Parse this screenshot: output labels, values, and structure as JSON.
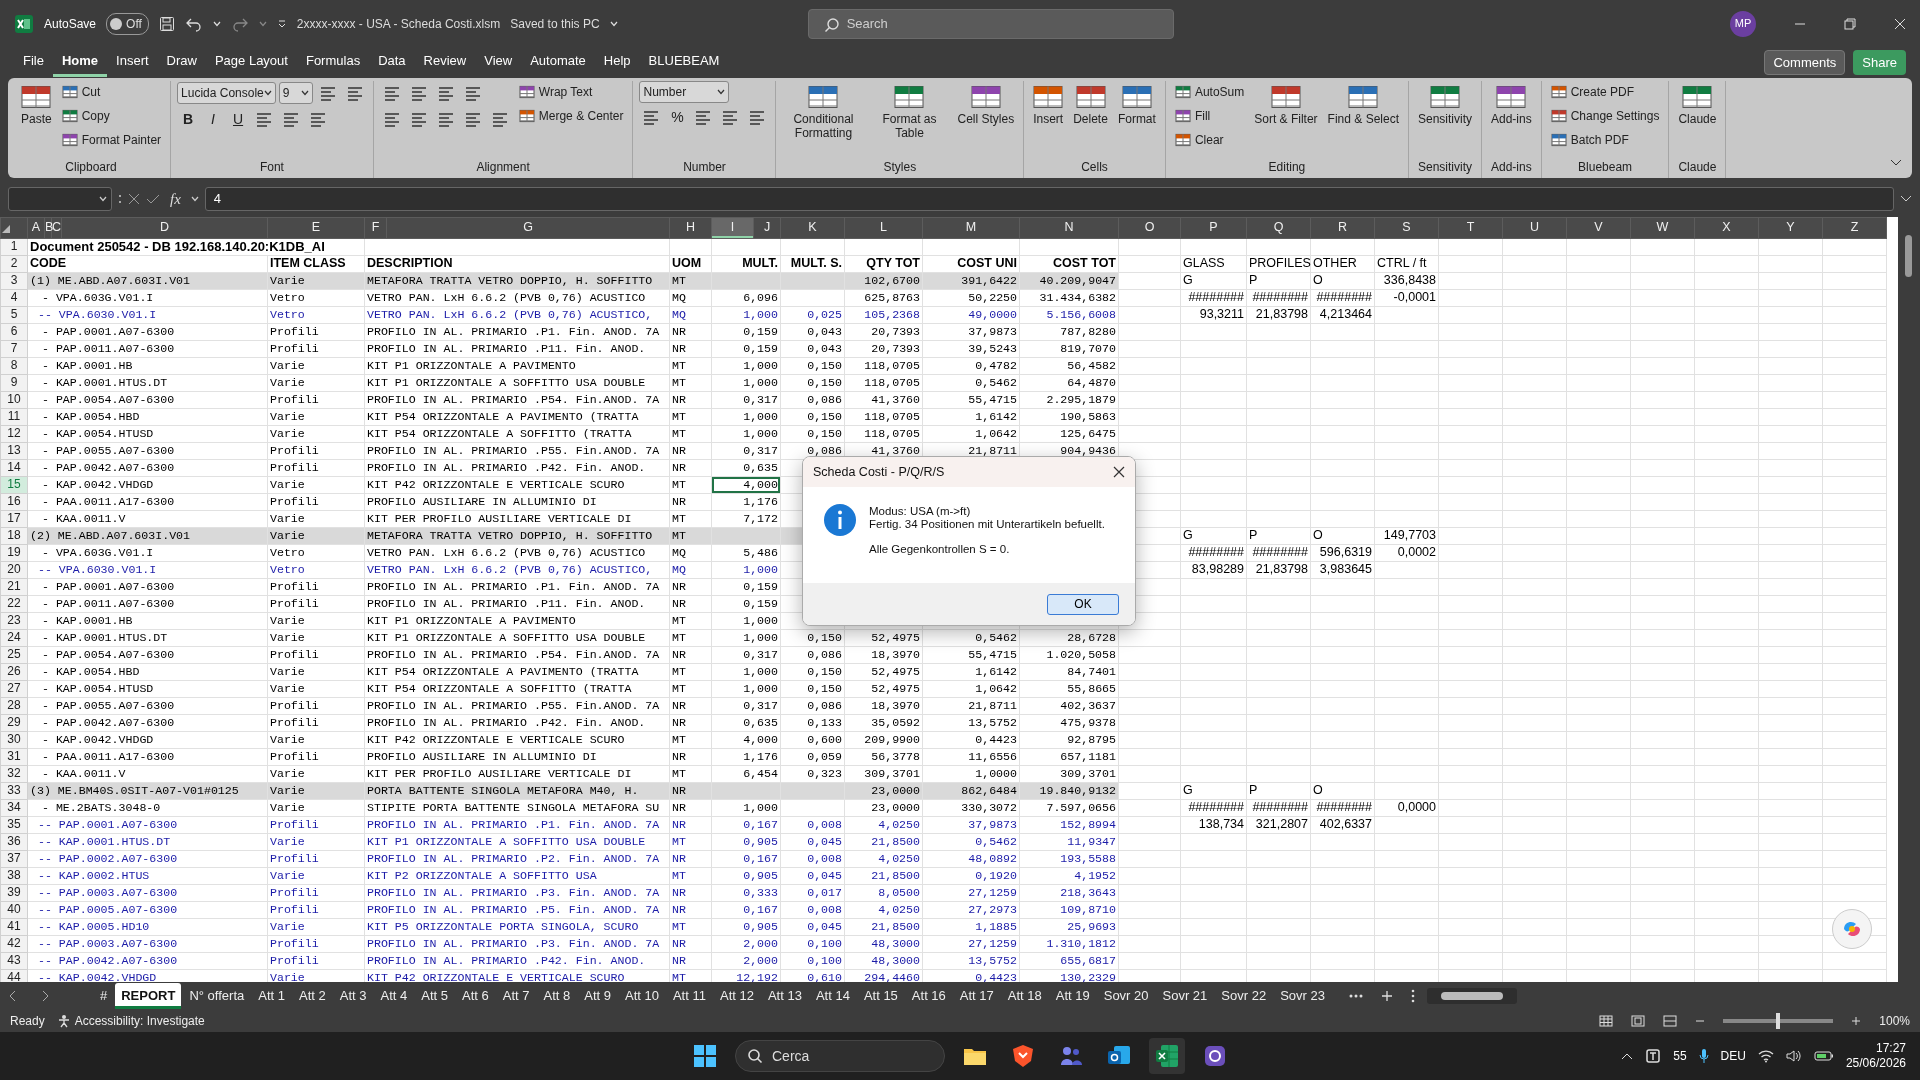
{
  "title_bar": {
    "autosave_label": "AutoSave",
    "autosave_on": false,
    "autosave_text": "Off",
    "file_name": "2xxxx-xxxx - USA - Scheda Costi.xlsm",
    "save_status": "Saved to this PC",
    "search_placeholder": "Search",
    "avatar": "MP"
  },
  "menu_tabs": [
    {
      "label": "File",
      "selected": false
    },
    {
      "label": "Home",
      "selected": true
    },
    {
      "label": "Insert",
      "selected": false
    },
    {
      "label": "Draw",
      "selected": false
    },
    {
      "label": "Page Layout",
      "selected": false
    },
    {
      "label": "Formulas",
      "selected": false
    },
    {
      "label": "Data",
      "selected": false
    },
    {
      "label": "Review",
      "selected": false
    },
    {
      "label": "View",
      "selected": false
    },
    {
      "label": "Automate",
      "selected": false
    },
    {
      "label": "Help",
      "selected": false
    },
    {
      "label": "BLUEBEAM",
      "selected": false
    }
  ],
  "comments_button": "Comments",
  "share_button": "Share",
  "ribbon": [
    {
      "label": "Clipboard",
      "columns": [
        [
          [
            {
              "kind": "large",
              "label": "Paste"
            }
          ]
        ],
        [
          [
            {
              "kind": "small",
              "label": "Cut"
            }
          ],
          [
            {
              "kind": "small",
              "label": "Copy"
            }
          ],
          [
            {
              "kind": "small",
              "label": "Format Painter"
            }
          ]
        ]
      ]
    },
    {
      "label": "Font",
      "columns": [
        [
          [
            {
              "kind": "combo",
              "value": "Lucida Console"
            },
            {
              "kind": "combo",
              "value": "9"
            },
            {
              "kind": "icon"
            },
            {
              "kind": "icon"
            }
          ],
          [
            {
              "kind": "bold",
              "label": "B"
            },
            {
              "kind": "italic",
              "label": "I"
            },
            {
              "kind": "underline",
              "label": "U"
            },
            {
              "kind": "icon"
            },
            {
              "kind": "icon"
            },
            {
              "kind": "icon"
            }
          ]
        ]
      ]
    },
    {
      "label": "Alignment",
      "columns": [
        [
          [
            {
              "kind": "icon"
            },
            {
              "kind": "icon"
            },
            {
              "kind": "icon"
            },
            {
              "kind": "icon"
            }
          ],
          [
            {
              "kind": "icon"
            },
            {
              "kind": "icon"
            },
            {
              "kind": "icon"
            },
            {
              "kind": "icon"
            },
            {
              "kind": "icon"
            }
          ]
        ],
        [
          [
            {
              "kind": "small",
              "label": "Wrap Text"
            }
          ],
          [
            {
              "kind": "small",
              "label": "Merge & Center"
            }
          ]
        ]
      ]
    },
    {
      "label": "Number",
      "columns": [
        [
          [
            {
              "kind": "combo",
              "value": "Number"
            }
          ],
          [
            {
              "kind": "icon"
            },
            {
              "kind": "glyph",
              "label": "%"
            },
            {
              "kind": "icon"
            },
            {
              "kind": "icon"
            },
            {
              "kind": "icon"
            }
          ]
        ]
      ]
    },
    {
      "label": "Styles",
      "columns": [
        [
          [
            {
              "kind": "large",
              "label": "Conditional Formatting"
            }
          ]
        ],
        [
          [
            {
              "kind": "large",
              "label": "Format as Table"
            }
          ]
        ],
        [
          [
            {
              "kind": "large",
              "label": "Cell Styles"
            }
          ]
        ]
      ]
    },
    {
      "label": "Cells",
      "columns": [
        [
          [
            {
              "kind": "large",
              "label": "Insert"
            }
          ]
        ],
        [
          [
            {
              "kind": "large",
              "label": "Delete"
            }
          ]
        ],
        [
          [
            {
              "kind": "large",
              "label": "Format"
            }
          ]
        ]
      ]
    },
    {
      "label": "Editing",
      "columns": [
        [
          [
            {
              "kind": "small",
              "label": "AutoSum"
            }
          ],
          [
            {
              "kind": "small",
              "label": "Fill"
            }
          ],
          [
            {
              "kind": "small",
              "label": "Clear"
            }
          ]
        ],
        [
          [
            {
              "kind": "large",
              "label": "Sort & Filter"
            }
          ]
        ],
        [
          [
            {
              "kind": "large",
              "label": "Find & Select"
            }
          ]
        ]
      ]
    },
    {
      "label": "Sensitivity",
      "columns": [
        [
          [
            {
              "kind": "large",
              "label": "Sensitivity"
            }
          ]
        ]
      ]
    },
    {
      "label": "Add-ins",
      "columns": [
        [
          [
            {
              "kind": "large",
              "label": "Add-ins"
            }
          ]
        ]
      ]
    },
    {
      "label": "Bluebeam",
      "columns": [
        [
          [
            {
              "kind": "small",
              "label": "Create PDF"
            }
          ],
          [
            {
              "kind": "small",
              "label": "Change Settings"
            }
          ],
          [
            {
              "kind": "small",
              "label": "Batch PDF"
            }
          ]
        ]
      ]
    },
    {
      "label": "Claude",
      "columns": [
        [
          [
            {
              "kind": "large",
              "label": "Claude"
            }
          ]
        ]
      ]
    }
  ],
  "formula_bar": {
    "fx_label": "fx",
    "value": "4"
  },
  "sheet": {
    "columns": [
      {
        "label": "A",
        "selected": false
      },
      {
        "label": "B",
        "selected": false
      },
      {
        "label": "C",
        "selected": false
      },
      {
        "label": "D",
        "selected": false
      },
      {
        "label": "E",
        "selected": false
      },
      {
        "label": "F",
        "selected": false
      },
      {
        "label": "G",
        "selected": false
      },
      {
        "label": "H",
        "selected": false
      },
      {
        "label": "I",
        "selected": true
      },
      {
        "label": "J",
        "selected": false
      },
      {
        "label": "K",
        "selected": false
      },
      {
        "label": "L",
        "selected": false
      },
      {
        "label": "M",
        "selected": false
      },
      {
        "label": "N",
        "selected": false
      },
      {
        "label": "O",
        "selected": false
      },
      {
        "label": "P",
        "selected": false
      },
      {
        "label": "Q",
        "selected": false
      },
      {
        "label": "R",
        "selected": false
      },
      {
        "label": "S",
        "selected": false
      },
      {
        "label": "T",
        "selected": false
      },
      {
        "label": "U",
        "selected": false
      },
      {
        "label": "V",
        "selected": false
      },
      {
        "label": "W",
        "selected": false
      },
      {
        "label": "X",
        "selected": false
      },
      {
        "label": "Y",
        "selected": false
      },
      {
        "label": "Z",
        "selected": false
      }
    ],
    "rows": [
      {
        "n": "1",
        "kind": "title",
        "selected": false,
        "cells": {
          "A": "Document 250542 - DB 192.168.140.20:K1DB_AI"
        }
      },
      {
        "n": "2",
        "kind": "header",
        "selected": false,
        "cells": {
          "A": "CODE",
          "E": "ITEM CLASS",
          "F": "DESCRIPTION",
          "H": "UOM",
          "I": "MULT.",
          "K": "MULT. S.",
          "L": "QTY TOT",
          "M": "COST UNI",
          "N": "COST TOT",
          "P": "GLASS",
          "Q": "PROFILES",
          "R": "OTHER",
          "S": "CTRL / ft"
        }
      },
      {
        "n": "3",
        "kind": "group",
        "selected": false,
        "cells": {
          "A": "(1) ME.ABD.A07.603I.V01",
          "E": "Varie",
          "F": "METAFORA TRATTA VETRO DOPPIO, H. SOFFITTO",
          "H": "MT",
          "L": "102,6700",
          "M": "391,6422",
          "N": "40.209,9047",
          "P": "G",
          "Q": "P",
          "R": "O",
          "S": "336,8438"
        }
      },
      {
        "n": "4",
        "kind": "item",
        "selected": false,
        "cells": {
          "A": "- VPA.603G.V01.I",
          "E": "Vetro",
          "F": "VETRO PAN. LxH 6.6.2 (PVB 0,76) ACUSTICO",
          "H": "MQ",
          "I": "6,096",
          "L": "625,8763",
          "M": "50,2250",
          "N": "31.434,6382",
          "P": "########",
          "Q": "########",
          "R": "########",
          "S": "-0,0001"
        }
      },
      {
        "n": "5",
        "kind": "sub",
        "selected": false,
        "cells": {
          "A": "-- VPA.6030.V01.I",
          "E": "Vetro",
          "F": "VETRO PAN. LxH 6.6.2 (PVB 0,76) ACUSTICO,",
          "H": "MQ",
          "I": "1,000",
          "K": "0,025",
          "L": "105,2368",
          "M": "49,0000",
          "N": "5.156,6008",
          "P": "93,3211",
          "Q": "21,83798",
          "R": "4,213464"
        }
      },
      {
        "n": "6",
        "kind": "item",
        "selected": false,
        "cells": {
          "A": "- PAP.0001.A07-6300",
          "E": "Profili",
          "F": "PROFILO IN AL. PRIMARIO .P1. Fin. ANOD. 7A",
          "H": "NR",
          "I": "0,159",
          "K": "0,043",
          "L": "20,7393",
          "M": "37,9873",
          "N": "787,8280"
        }
      },
      {
        "n": "7",
        "kind": "item",
        "selected": false,
        "cells": {
          "A": "- PAP.0011.A07-6300",
          "E": "Profili",
          "F": "PROFILO IN AL. PRIMARIO .P11. Fin. ANOD.",
          "H": "NR",
          "I": "0,159",
          "K": "0,043",
          "L": "20,7393",
          "M": "39,5243",
          "N": "819,7070"
        }
      },
      {
        "n": "8",
        "kind": "item",
        "selected": false,
        "cells": {
          "A": "- KAP.0001.HB",
          "E": "Varie",
          "F": "KIT P1 ORIZZONTALE A PAVIMENTO",
          "H": "MT",
          "I": "1,000",
          "K": "0,150",
          "L": "118,0705",
          "M": "0,4782",
          "N": "56,4582"
        }
      },
      {
        "n": "9",
        "kind": "item",
        "selected": false,
        "cells": {
          "A": "- KAP.0001.HTUS.DT",
          "E": "Varie",
          "F": "KIT P1 ORIZZONTALE A SOFFITTO USA DOUBLE",
          "H": "MT",
          "I": "1,000",
          "K": "0,150",
          "L": "118,0705",
          "M": "0,5462",
          "N": "64,4870"
        }
      },
      {
        "n": "10",
        "kind": "item",
        "selected": false,
        "cells": {
          "A": "- PAP.0054.A07-6300",
          "E": "Profili",
          "F": "PROFILO IN AL. PRIMARIO .P54. Fin.ANOD. 7A",
          "H": "NR",
          "I": "0,317",
          "K": "0,086",
          "L": "41,3760",
          "M": "55,4715",
          "N": "2.295,1879"
        }
      },
      {
        "n": "11",
        "kind": "item",
        "selected": false,
        "cells": {
          "A": "- KAP.0054.HBD",
          "E": "Varie",
          "F": "KIT P54 ORIZZONTALE A PAVIMENTO (TRATTA",
          "H": "MT",
          "I": "1,000",
          "K": "0,150",
          "L": "118,0705",
          "M": "1,6142",
          "N": "190,5863"
        }
      },
      {
        "n": "12",
        "kind": "item",
        "selected": false,
        "cells": {
          "A": "- KAP.0054.HTUSD",
          "E": "Varie",
          "F": "KIT P54 ORIZZONTALE A SOFFITTO (TRATTA",
          "H": "MT",
          "I": "1,000",
          "K": "0,150",
          "L": "118,0705",
          "M": "1,0642",
          "N": "125,6475"
        }
      },
      {
        "n": "13",
        "kind": "item",
        "selected": false,
        "cells": {
          "A": "- PAP.0055.A07-6300",
          "E": "Profili",
          "F": "PROFILO IN AL. PRIMARIO .P55. Fin.ANOD. 7A",
          "H": "NR",
          "I": "0,317",
          "K": "0,086",
          "L": "41,3760",
          "M": "21,8711",
          "N": "904,9436"
        }
      },
      {
        "n": "14",
        "kind": "item",
        "selected": false,
        "cells": {
          "A": "- PAP.0042.A07-6300",
          "E": "Profili",
          "F": "PROFILO IN AL. PRIMARIO .P42. Fin. ANOD.",
          "H": "NR",
          "I": "0,635"
        }
      },
      {
        "n": "15",
        "kind": "item",
        "selected": true,
        "cells": {
          "A": "- KAP.0042.VHDGD",
          "E": "Varie",
          "F": "KIT P42 ORIZZONTALE E VERTICALE SCURO",
          "H": "MT",
          "I": "4,000"
        }
      },
      {
        "n": "16",
        "kind": "item",
        "selected": false,
        "cells": {
          "A": "- PAA.0011.A17-6300",
          "E": "Profili",
          "F": "PROFILO AUSILIARE IN ALLUMINIO DI",
          "H": "NR",
          "I": "1,176"
        }
      },
      {
        "n": "17",
        "kind": "item",
        "selected": false,
        "cells": {
          "A": "- KAA.0011.V",
          "E": "Varie",
          "F": "KIT PER PROFILO AUSILIARE VERTICALE DI",
          "H": "MT",
          "I": "7,172"
        }
      },
      {
        "n": "18",
        "kind": "group",
        "selected": false,
        "cells": {
          "A": "(2) ME.ABD.A07.603I.V01",
          "E": "Varie",
          "F": "METAFORA TRATTA VETRO DOPPIO, H. SOFFITTO",
          "H": "MT",
          "P": "G",
          "Q": "P",
          "R": "O",
          "S": "149,7703"
        }
      },
      {
        "n": "19",
        "kind": "item",
        "selected": false,
        "cells": {
          "A": "- VPA.603G.V01.I",
          "E": "Vetro",
          "F": "VETRO PAN. LxH 6.6.2 (PVB 0,76) ACUSTICO",
          "H": "MQ",
          "I": "5,486",
          "P": "########",
          "Q": "########",
          "R": "596,6319",
          "S": "0,0002"
        }
      },
      {
        "n": "20",
        "kind": "sub",
        "selected": false,
        "cells": {
          "A": "-- VPA.6030.V01.I",
          "E": "Vetro",
          "F": "VETRO PAN. LxH 6.6.2 (PVB 0,76) ACUSTICO,",
          "H": "MQ",
          "I": "1,000",
          "P": "83,98289",
          "Q": "21,83798",
          "R": "3,983645"
        }
      },
      {
        "n": "21",
        "kind": "item",
        "selected": false,
        "cells": {
          "A": "- PAP.0001.A07-6300",
          "E": "Profili",
          "F": "PROFILO IN AL. PRIMARIO .P1. Fin. ANOD. 7A",
          "H": "NR",
          "I": "0,159"
        }
      },
      {
        "n": "22",
        "kind": "item",
        "selected": false,
        "cells": {
          "A": "- PAP.0011.A07-6300",
          "E": "Profili",
          "F": "PROFILO IN AL. PRIMARIO .P11. Fin. ANOD.",
          "H": "NR",
          "I": "0,159"
        }
      },
      {
        "n": "23",
        "kind": "item",
        "selected": false,
        "cells": {
          "A": "- KAP.0001.HB",
          "E": "Varie",
          "F": "KIT P1 ORIZZONTALE A PAVIMENTO",
          "H": "MT",
          "I": "1,000"
        }
      },
      {
        "n": "24",
        "kind": "item",
        "selected": false,
        "cells": {
          "A": "- KAP.0001.HTUS.DT",
          "E": "Varie",
          "F": "KIT P1 ORIZZONTALE A SOFFITTO USA DOUBLE",
          "H": "MT",
          "I": "1,000",
          "K": "0,150",
          "L": "52,4975",
          "M": "0,5462",
          "N": "28,6728"
        }
      },
      {
        "n": "25",
        "kind": "item",
        "selected": false,
        "cells": {
          "A": "- PAP.0054.A07-6300",
          "E": "Profili",
          "F": "PROFILO IN AL. PRIMARIO .P54. Fin.ANOD. 7A",
          "H": "NR",
          "I": "0,317",
          "K": "0,086",
          "L": "18,3970",
          "M": "55,4715",
          "N": "1.020,5058"
        }
      },
      {
        "n": "26",
        "kind": "item",
        "selected": false,
        "cells": {
          "A": "- KAP.0054.HBD",
          "E": "Varie",
          "F": "KIT P54 ORIZZONTALE A PAVIMENTO (TRATTA",
          "H": "MT",
          "I": "1,000",
          "K": "0,150",
          "L": "52,4975",
          "M": "1,6142",
          "N": "84,7401"
        }
      },
      {
        "n": "27",
        "kind": "item",
        "selected": false,
        "cells": {
          "A": "- KAP.0054.HTUSD",
          "E": "Varie",
          "F": "KIT P54 ORIZZONTALE A SOFFITTO (TRATTA",
          "H": "MT",
          "I": "1,000",
          "K": "0,150",
          "L": "52,4975",
          "M": "1,0642",
          "N": "55,8665"
        }
      },
      {
        "n": "28",
        "kind": "item",
        "selected": false,
        "cells": {
          "A": "- PAP.0055.A07-6300",
          "E": "Profili",
          "F": "PROFILO IN AL. PRIMARIO .P55. Fin.ANOD. 7A",
          "H": "NR",
          "I": "0,317",
          "K": "0,086",
          "L": "18,3970",
          "M": "21,8711",
          "N": "402,3637"
        }
      },
      {
        "n": "29",
        "kind": "item",
        "selected": false,
        "cells": {
          "A": "- PAP.0042.A07-6300",
          "E": "Profili",
          "F": "PROFILO IN AL. PRIMARIO .P42. Fin. ANOD.",
          "H": "NR",
          "I": "0,635",
          "K": "0,133",
          "L": "35,0592",
          "M": "13,5752",
          "N": "475,9378"
        }
      },
      {
        "n": "30",
        "kind": "item",
        "selected": false,
        "cells": {
          "A": "- KAP.0042.VHDGD",
          "E": "Varie",
          "F": "KIT P42 ORIZZONTALE E VERTICALE SCURO",
          "H": "MT",
          "I": "4,000",
          "K": "0,600",
          "L": "209,9900",
          "M": "0,4423",
          "N": "92,8795"
        }
      },
      {
        "n": "31",
        "kind": "item",
        "selected": false,
        "cells": {
          "A": "- PAA.0011.A17-6300",
          "E": "Profili",
          "F": "PROFILO AUSILIARE IN ALLUMINIO DI",
          "H": "NR",
          "I": "1,176",
          "K": "0,059",
          "L": "56,3778",
          "M": "11,6556",
          "N": "657,1181"
        }
      },
      {
        "n": "32",
        "kind": "item",
        "selected": false,
        "cells": {
          "A": "- KAA.0011.V",
          "E": "Varie",
          "F": "KIT PER PROFILO AUSILIARE VERTICALE DI",
          "H": "MT",
          "I": "6,454",
          "K": "0,323",
          "L": "309,3701",
          "M": "1,0000",
          "N": "309,3701"
        }
      },
      {
        "n": "33",
        "kind": "group",
        "selected": false,
        "cells": {
          "A": "(3) ME.BM40S.0SIT-A07-V01#0125",
          "E": "Varie",
          "F": "PORTA BATTENTE SINGOLA METAFORA M40, H.",
          "H": "NR",
          "L": "23,0000",
          "M": "862,6484",
          "N": "19.840,9132",
          "P": "G",
          "Q": "P",
          "R": "O"
        }
      },
      {
        "n": "34",
        "kind": "item",
        "selected": false,
        "cells": {
          "A": "- ME.2BATS.3048-0",
          "E": "Varie",
          "F": "STIPITE PORTA BATTENTE SINGOLA METAFORA SU",
          "H": "NR",
          "I": "1,000",
          "L": "23,0000",
          "M": "330,3072",
          "N": "7.597,0656",
          "P": "########",
          "Q": "########",
          "R": "########",
          "S": "0,0000"
        }
      },
      {
        "n": "35",
        "kind": "sub",
        "selected": false,
        "cells": {
          "A": "-- PAP.0001.A07-6300",
          "E": "Profili",
          "F": "PROFILO IN AL. PRIMARIO .P1. Fin. ANOD. 7A",
          "H": "NR",
          "I": "0,167",
          "K": "0,008",
          "L": "4,0250",
          "M": "37,9873",
          "N": "152,8994",
          "P": "138,734",
          "Q": "321,2807",
          "R": "402,6337"
        }
      },
      {
        "n": "36",
        "kind": "sub",
        "selected": false,
        "cells": {
          "A": "-- KAP.0001.HTUS.DT",
          "E": "Varie",
          "F": "KIT P1 ORIZZONTALE A SOFFITTO USA DOUBLE",
          "H": "MT",
          "I": "0,905",
          "K": "0,045",
          "L": "21,8500",
          "M": "0,5462",
          "N": "11,9347"
        }
      },
      {
        "n": "37",
        "kind": "sub",
        "selected": false,
        "cells": {
          "A": "-- PAP.0002.A07-6300",
          "E": "Profili",
          "F": "PROFILO IN AL. PRIMARIO .P2. Fin. ANOD. 7A",
          "H": "NR",
          "I": "0,167",
          "K": "0,008",
          "L": "4,0250",
          "M": "48,0892",
          "N": "193,5588"
        }
      },
      {
        "n": "38",
        "kind": "sub",
        "selected": false,
        "cells": {
          "A": "-- KAP.0002.HTUS",
          "E": "Varie",
          "F": "KIT P2 ORIZZONTALE A SOFFITTO USA",
          "H": "MT",
          "I": "0,905",
          "K": "0,045",
          "L": "21,8500",
          "M": "0,1920",
          "N": "4,1952"
        }
      },
      {
        "n": "39",
        "kind": "sub",
        "selected": false,
        "cells": {
          "A": "-- PAP.0003.A07-6300",
          "E": "Profili",
          "F": "PROFILO IN AL. PRIMARIO .P3. Fin. ANOD. 7A",
          "H": "NR",
          "I": "0,333",
          "K": "0,017",
          "L": "8,0500",
          "M": "27,1259",
          "N": "218,3643"
        }
      },
      {
        "n": "40",
        "kind": "sub",
        "selected": false,
        "cells": {
          "A": "-- PAP.0005.A07-6300",
          "E": "Profili",
          "F": "PROFILO IN AL. PRIMARIO .P5. Fin. ANOD. 7A",
          "H": "NR",
          "I": "0,167",
          "K": "0,008",
          "L": "4,0250",
          "M": "27,2973",
          "N": "109,8710"
        }
      },
      {
        "n": "41",
        "kind": "sub",
        "selected": false,
        "cells": {
          "A": "-- KAP.0005.HD10",
          "E": "Varie",
          "F": "KIT P5 ORIZZONTALE PORTA SINGOLA, SCURO",
          "H": "MT",
          "I": "0,905",
          "K": "0,045",
          "L": "21,8500",
          "M": "1,1885",
          "N": "25,9693"
        }
      },
      {
        "n": "42",
        "kind": "sub",
        "selected": false,
        "cells": {
          "A": "-- PAP.0003.A07-6300",
          "E": "Profili",
          "F": "PROFILO IN AL. PRIMARIO .P3. Fin. ANOD. 7A",
          "H": "NR",
          "I": "2,000",
          "K": "0,100",
          "L": "48,3000",
          "M": "27,1259",
          "N": "1.310,1812"
        }
      },
      {
        "n": "43",
        "kind": "sub",
        "selected": false,
        "cells": {
          "A": "-- PAP.0042.A07-6300",
          "E": "Profili",
          "F": "PROFILO IN AL. PRIMARIO .P42. Fin. ANOD.",
          "H": "NR",
          "I": "2,000",
          "K": "0,100",
          "L": "48,3000",
          "M": "13,5752",
          "N": "655,6817"
        }
      },
      {
        "n": "44",
        "kind": "sub",
        "selected": false,
        "cells": {
          "A": "-- KAP.0042.VHDGD",
          "E": "Varie",
          "F": "KIT P42 ORIZZONTALE E VERTICALE SCURO",
          "H": "MT",
          "I": "12,192",
          "K": "0,610",
          "L": "294,4460",
          "M": "0,4423",
          "N": "130,2329"
        }
      }
    ]
  },
  "dialog": {
    "title": "Scheda Costi - P/Q/R/S",
    "lines": [
      "Modus: USA (m->ft)",
      "Fertig. 34 Positionen mit Unterartikeln befuellt."
    ],
    "note": "Alle Gegenkontrollen S = 0.",
    "ok_button": "OK"
  },
  "sheet_tabs": [
    {
      "label": "#",
      "selected": false
    },
    {
      "label": "REPORT",
      "selected": true
    },
    {
      "label": "N° offerta",
      "selected": false
    },
    {
      "label": "Att 1",
      "selected": false
    },
    {
      "label": "Att 2",
      "selected": false
    },
    {
      "label": "Att 3",
      "selected": false
    },
    {
      "label": "Att 4",
      "selected": false
    },
    {
      "label": "Att 5",
      "selected": false
    },
    {
      "label": "Att 6",
      "selected": false
    },
    {
      "label": "Att 7",
      "selected": false
    },
    {
      "label": "Att 8",
      "selected": false
    },
    {
      "label": "Att 9",
      "selected": false
    },
    {
      "label": "Att 10",
      "selected": false
    },
    {
      "label": "Att 11",
      "selected": false
    },
    {
      "label": "Att 12",
      "selected": false
    },
    {
      "label": "Att 13",
      "selected": false
    },
    {
      "label": "Att 14",
      "selected": false
    },
    {
      "label": "Att 15",
      "selected": false
    },
    {
      "label": "Att 16",
      "selected": false
    },
    {
      "label": "Att 17",
      "selected": false
    },
    {
      "label": "Att 18",
      "selected": false
    },
    {
      "label": "Att 19",
      "selected": false
    },
    {
      "label": "Sovr 20",
      "selected": false
    },
    {
      "label": "Sovr 21",
      "selected": false
    },
    {
      "label": "Sovr 22",
      "selected": false
    },
    {
      "label": "Sovr 23",
      "selected": false
    }
  ],
  "status_bar": {
    "status": "Ready",
    "accessibility": "Accessibility: Investigate",
    "zoom_slider": {
      "level": 0.5
    },
    "zoom": "100%"
  },
  "taskbar": {
    "search_placeholder": "Cerca",
    "tray_count": "55",
    "language": "DEU",
    "time": "17:27",
    "date": "25/06/2026"
  }
}
